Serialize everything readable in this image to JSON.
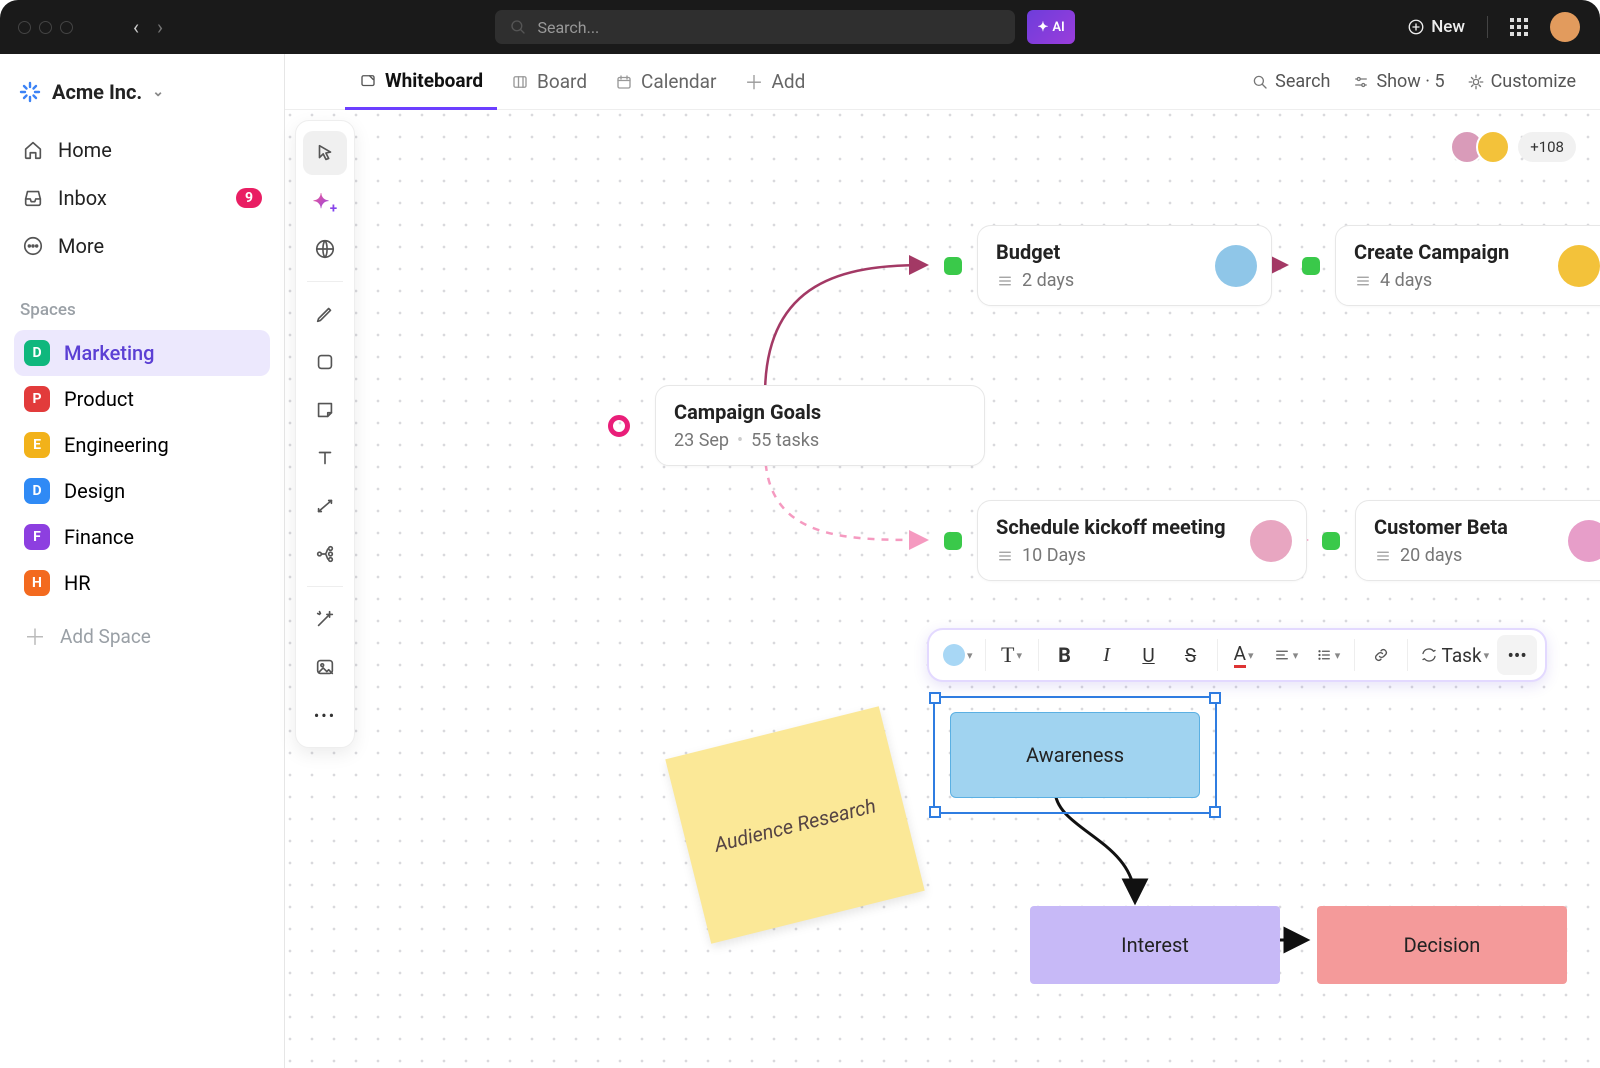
{
  "titlebar": {
    "search_placeholder": "Search...",
    "ai_label": "AI",
    "new_label": "New"
  },
  "org": {
    "name": "Acme Inc."
  },
  "nav": {
    "home": "Home",
    "inbox": "Inbox",
    "inbox_badge": "9",
    "more": "More"
  },
  "sidebar": {
    "section_label": "Spaces",
    "spaces": [
      {
        "letter": "D",
        "label": "Marketing",
        "color": "#0fb77d",
        "active": true
      },
      {
        "letter": "P",
        "label": "Product",
        "color": "#e23b3b"
      },
      {
        "letter": "E",
        "label": "Engineering",
        "color": "#f2b21a"
      },
      {
        "letter": "D",
        "label": "Design",
        "color": "#2f8af5"
      },
      {
        "letter": "F",
        "label": "Finance",
        "color": "#8d3fe0"
      },
      {
        "letter": "H",
        "label": "HR",
        "color": "#f36a1f"
      }
    ],
    "add_space": "Add Space"
  },
  "views": {
    "tabs": [
      "Whiteboard",
      "Board",
      "Calendar"
    ],
    "add": "Add",
    "search": "Search",
    "show": "Show · 5",
    "customize": "Customize"
  },
  "collab": {
    "more_count": "+108"
  },
  "cards": {
    "goals": {
      "title": "Campaign Goals",
      "sub_date": "23 Sep",
      "sub_tasks": "55 tasks"
    },
    "budget": {
      "title": "Budget",
      "sub": "2 days"
    },
    "create": {
      "title": "Create Campaign",
      "sub": "4 days"
    },
    "kickoff": {
      "title": "Schedule kickoff meeting",
      "sub": "10 Days"
    },
    "beta": {
      "title": "Customer Beta",
      "sub": "20 days"
    }
  },
  "sticky": {
    "text": "Audience Research"
  },
  "flow": {
    "awareness": "Awareness",
    "interest": "Interest",
    "decision": "Decision"
  },
  "text_toolbar": {
    "task_label": "Task"
  },
  "avatar_colors": {
    "user": "#e29b5d",
    "collab1": "#d99bb9",
    "collab2": "#f3c23a",
    "av_budget": "#8fc6e8",
    "av_create": "#f3c23a",
    "av_kickoff": "#e8a6c1",
    "av_beta": "#e79ec9"
  }
}
